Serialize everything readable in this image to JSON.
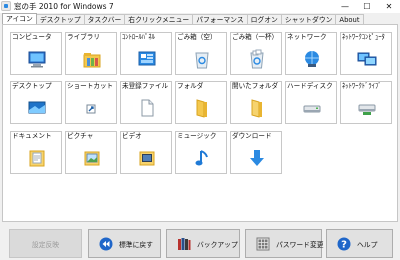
{
  "window": {
    "title": "窓の手 2010 for Windows 7",
    "controls": [
      "—",
      "☐",
      "✕"
    ]
  },
  "tabs": [
    {
      "label": "アイコン",
      "active": true
    },
    {
      "label": "デスクトップ",
      "active": false
    },
    {
      "label": "タスクバー",
      "active": false
    },
    {
      "label": "右クリックメニュー",
      "active": false
    },
    {
      "label": "パフォーマンス",
      "active": false
    },
    {
      "label": "ログオン",
      "active": false
    },
    {
      "label": "シャットダウン",
      "active": false
    },
    {
      "label": "About",
      "active": false
    }
  ],
  "tiles": [
    {
      "label": "コンピュータ",
      "icon": "computer-icon"
    },
    {
      "label": "ライブラリ",
      "icon": "library-icon"
    },
    {
      "label": "ｺﾝﾄﾛｰﾙﾊﾟﾈﾙ",
      "icon": "control-panel-icon"
    },
    {
      "label": "ごみ箱（空）",
      "icon": "recycle-bin-empty-icon"
    },
    {
      "label": "ごみ箱（一杯）",
      "icon": "recycle-bin-full-icon"
    },
    {
      "label": "ネットワーク",
      "icon": "network-icon"
    },
    {
      "label": "ﾈｯﾄﾜｰｸｺﾝﾋﾟｭｰﾀ",
      "icon": "network-computer-icon"
    },
    {
      "label": "デスクトップ",
      "icon": "desktop-icon"
    },
    {
      "label": "ショートカット",
      "icon": "shortcut-icon"
    },
    {
      "label": "未登録ファイル",
      "icon": "unregistered-file-icon"
    },
    {
      "label": "フォルダ",
      "icon": "folder-icon"
    },
    {
      "label": "開いたフォルダ",
      "icon": "open-folder-icon"
    },
    {
      "label": "ハードディスク",
      "icon": "hard-disk-icon"
    },
    {
      "label": "ﾈｯﾄﾜｰｸﾄﾞﾗｲﾌﾞ",
      "icon": "network-drive-icon"
    },
    {
      "label": "ドキュメント",
      "icon": "documents-icon"
    },
    {
      "label": "ピクチャ",
      "icon": "pictures-icon"
    },
    {
      "label": "ビデオ",
      "icon": "videos-icon"
    },
    {
      "label": "ミュージック",
      "icon": "music-icon"
    },
    {
      "label": "ダウンロード",
      "icon": "downloads-icon"
    }
  ],
  "buttons": {
    "apply": "設定反映",
    "restore": "標準に戻す",
    "backup": "バックアップ",
    "password": "パスワード変更",
    "help": "ヘルプ"
  },
  "colors": {
    "accent_blue": "#2b8ae2",
    "folder_yellow": "#f4c84e",
    "disabled_text": "#9a9a9a"
  }
}
